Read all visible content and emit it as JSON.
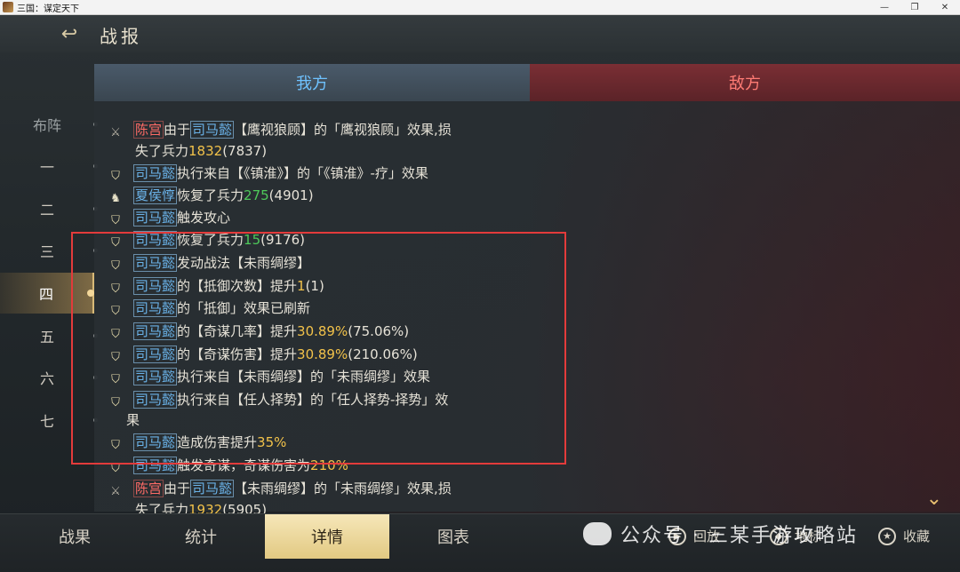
{
  "window": {
    "title": "三国：谋定天下",
    "controls": [
      "—",
      "❐",
      "✕"
    ]
  },
  "header": {
    "title": "战报",
    "back_icon": "back-arrow-icon"
  },
  "rounds": [
    {
      "label": "布阵",
      "active": false
    },
    {
      "label": "一",
      "active": false
    },
    {
      "label": "二",
      "active": false
    },
    {
      "label": "三",
      "active": false
    },
    {
      "label": "四",
      "active": true
    },
    {
      "label": "五",
      "active": false
    },
    {
      "label": "六",
      "active": false
    },
    {
      "label": "七",
      "active": false
    }
  ],
  "tabs": {
    "ours": "我方",
    "enemy": "敌方"
  },
  "log": {
    "line1a": {
      "icon": "crossed-swords-icon",
      "name": "陈宫",
      "pre": "由于",
      "name2": "司马懿",
      "mid": "【鹰视狼顾】的「鹰视狼顾」效果,损"
    },
    "line1b": {
      "pre": "失了兵力",
      "num": "1832",
      "post": "(7837)"
    },
    "line2": {
      "name": "司马懿",
      "text": "执行来自【《镇淮》】的「《镇淮》-疗」效果"
    },
    "line3": {
      "name": "夏侯惇",
      "pre": "恢复了兵力",
      "num": "275",
      "post": "(4901)"
    },
    "line4": {
      "name": "司马懿",
      "text": "触发攻心"
    },
    "line5": {
      "name": "司马懿",
      "pre": "恢复了兵力",
      "num": "15",
      "post": "(9176)"
    },
    "line6": {
      "name": "司马懿",
      "text": "发动战法【未雨绸缪】"
    },
    "line7": {
      "name": "司马懿",
      "pre": "的【抵御次数】提升",
      "num": "1",
      "post": "(1)"
    },
    "line8": {
      "name": "司马懿",
      "text": "的「抵御」效果已刷新"
    },
    "line9": {
      "name": "司马懿",
      "pre": "的【奇谋几率】提升",
      "num": "30.89%",
      "post": "(75.06%)"
    },
    "line10": {
      "name": "司马懿",
      "pre": "的【奇谋伤害】提升",
      "num": "30.89%",
      "post": "(210.06%)"
    },
    "line11": {
      "name": "司马懿",
      "text": "执行来自【未雨绸缪】的「未雨绸缪」效果"
    },
    "line12a": {
      "name": "司马懿",
      "text": "执行来自【任人择势】的「任人择势-择势」效"
    },
    "line12b": {
      "text": "果"
    },
    "line13": {
      "name": "司马懿",
      "pre": "造成伤害提升",
      "num": "35%"
    },
    "line14": {
      "name": "司马懿",
      "pre": "触发奇谋，奇谋伤害为",
      "num": "210%"
    },
    "line15a": {
      "name": "陈宫",
      "pre": "由于",
      "name2": "司马懿",
      "mid": "【未雨绸缪】的「未雨绸缪」效果,损"
    },
    "line15b": {
      "pre": "失了兵力",
      "num": "1932",
      "post": "(5905)"
    }
  },
  "bottom": {
    "tabs": [
      "战果",
      "统计",
      "详情",
      "图表"
    ],
    "active": "详情",
    "actions": [
      "回放",
      "地标",
      "收藏"
    ]
  },
  "watermark": "公众号 · 三某手游攻略站",
  "colors": {
    "ours": "#6ab2e8",
    "enemy": "#ff6b66",
    "gold": "#f2c24a",
    "green": "#4ec95a",
    "highlight": "#e33b3b"
  }
}
